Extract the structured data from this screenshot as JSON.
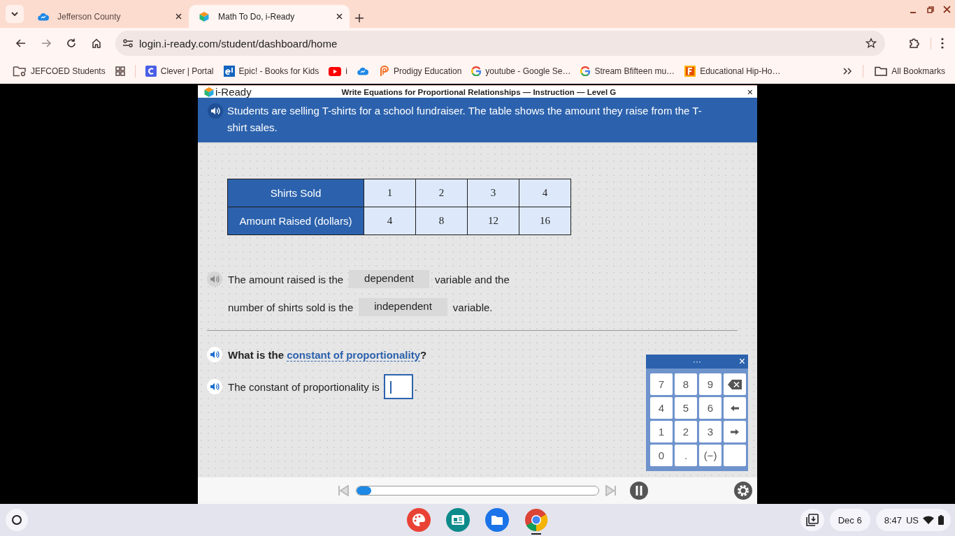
{
  "browser": {
    "tabs": [
      {
        "title": "Jefferson County",
        "kind": "cloud",
        "selected": false
      },
      {
        "title": "Math To Do, i-Ready",
        "kind": "cube",
        "selected": true
      }
    ],
    "address": "login.i-ready.com/student/dashboard/home",
    "bookmarks": [
      {
        "kind": "folder",
        "label": "JEFCOED Students"
      },
      {
        "kind": "apps"
      },
      {
        "kind": "clever",
        "label": "Clever | Portal"
      },
      {
        "kind": "epic",
        "label": "Epic! - Books for Kids"
      },
      {
        "kind": "video",
        "label": "i"
      },
      {
        "kind": "cloud"
      },
      {
        "kind": "prodigy",
        "label": "Prodigy Education"
      },
      {
        "kind": "google",
        "label": "youtube - Google Se…"
      },
      {
        "kind": "google",
        "label": "Stream Bfifteen mu…"
      },
      {
        "kind": "flocab",
        "label": "Educational Hip-Ho…"
      }
    ],
    "all_bookmarks": "All Bookmarks"
  },
  "lesson": {
    "app_name": "i-Ready",
    "title": "Write Equations for Proportional Relationships — Instruction — Level G",
    "close": "×",
    "prompt": "Students are selling T-shirts for a school fundraiser. The table shows the amount they raise from the T-shirt sales.",
    "table": [
      {
        "header": "Shirts Sold",
        "cells": [
          "1",
          "2",
          "3",
          "4"
        ]
      },
      {
        "header": "Amount Raised (dollars)",
        "cells": [
          "4",
          "8",
          "12",
          "16"
        ]
      }
    ],
    "statements": [
      {
        "before": "The amount raised is the",
        "answer": "dependent",
        "after": "variable and the"
      },
      {
        "before": "number of shirts sold is the",
        "answer": "independent",
        "after": "variable."
      }
    ],
    "question": {
      "before": "What is the",
      "term": "constant of proportionality",
      "after": "?"
    },
    "answer_line": {
      "before": "The constant of proportionality is",
      "after": "."
    },
    "keypad": {
      "handle": "···",
      "close": "×",
      "keys": [
        {
          "kind": "digit",
          "label": "7"
        },
        {
          "kind": "digit",
          "label": "8"
        },
        {
          "kind": "digit",
          "label": "9"
        },
        {
          "kind": "backspace"
        },
        {
          "kind": "digit",
          "label": "4"
        },
        {
          "kind": "digit",
          "label": "5"
        },
        {
          "kind": "digit",
          "label": "6"
        },
        {
          "kind": "left"
        },
        {
          "kind": "digit",
          "label": "1"
        },
        {
          "kind": "digit",
          "label": "2"
        },
        {
          "kind": "digit",
          "label": "3"
        },
        {
          "kind": "right"
        },
        {
          "kind": "digit",
          "label": "0"
        },
        {
          "kind": "digit",
          "label": "."
        },
        {
          "kind": "digit",
          "label": "(−)"
        },
        {
          "kind": "blank"
        }
      ]
    },
    "player": {
      "level": 0.06
    }
  },
  "shelf": {
    "date": "Dec 6",
    "time": "8:47",
    "locale": "US"
  }
}
